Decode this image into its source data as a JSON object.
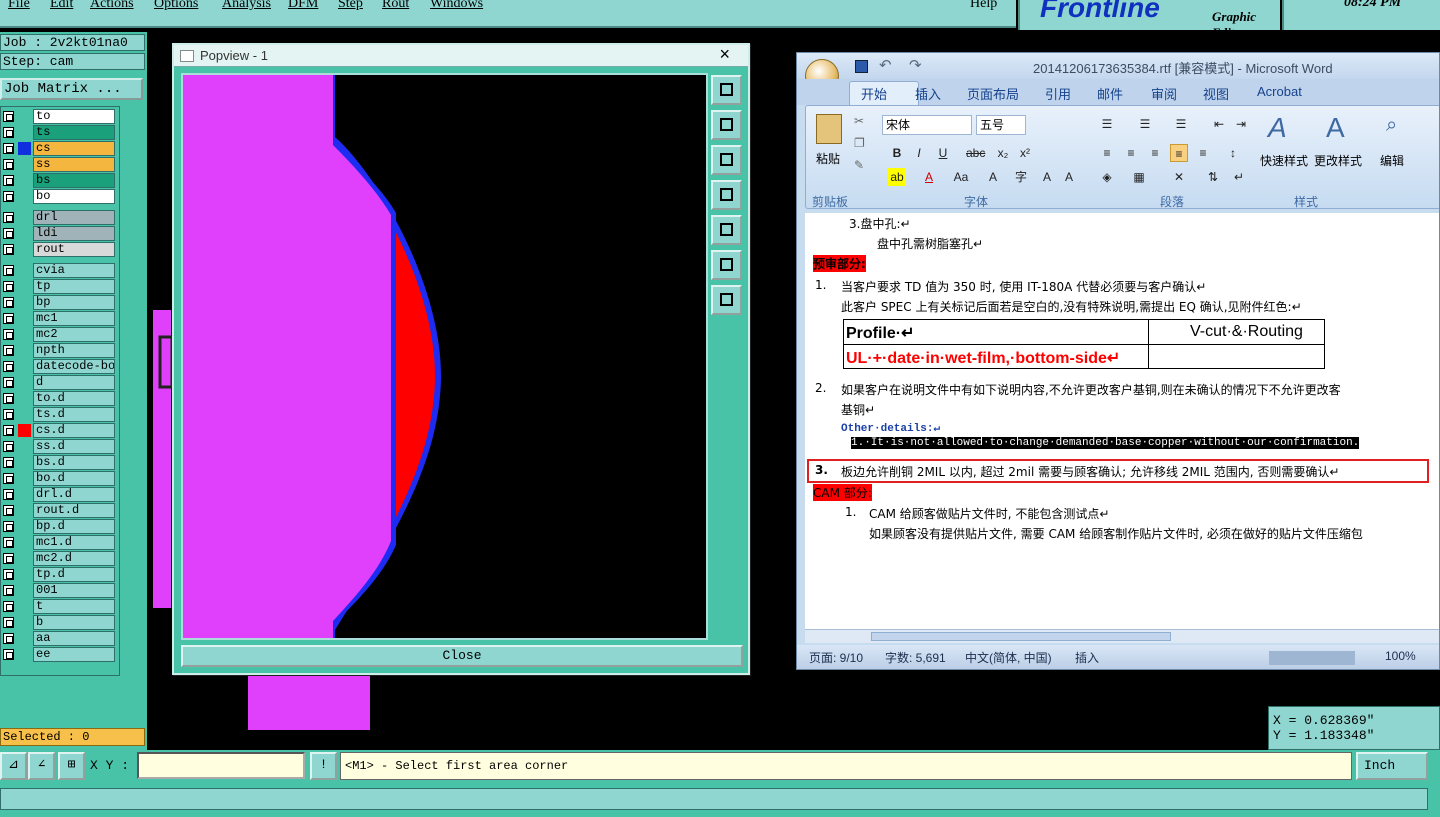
{
  "menu": {
    "items": [
      "File",
      "Edit",
      "Actions",
      "Options",
      "Analysis",
      "DFM",
      "Step",
      "Rout",
      "Windows"
    ],
    "help": "Help"
  },
  "brand": {
    "logo": "Frontline",
    "subtitle": "Graphic Editor"
  },
  "clock": "08:24 PM",
  "left_panel": {
    "job": "Job : 2v2kt01na0",
    "step": "Step: cam",
    "job_matrix": "Job Matrix ...",
    "selected": "Selected : 0",
    "layers": [
      {
        "name": "to",
        "color": "#ffffff",
        "swatch": ""
      },
      {
        "name": "ts",
        "color": "#1aa07a",
        "swatch": ""
      },
      {
        "name": "cs",
        "color": "#f4b63e",
        "swatch": "#1030e0"
      },
      {
        "name": "ss",
        "color": "#f4b63e",
        "swatch": ""
      },
      {
        "name": "bs",
        "color": "#1aa07a",
        "swatch": ""
      },
      {
        "name": "bo",
        "color": "#ffffff",
        "swatch": ""
      },
      {
        "name": "drl",
        "color": "#9fb3b8",
        "swatch": ""
      },
      {
        "name": "ldi",
        "color": "#9fb3b8",
        "swatch": ""
      },
      {
        "name": "rout",
        "color": "#d9d9d9",
        "swatch": ""
      },
      {
        "name": "cvia",
        "color": "#8fd6d0",
        "swatch": ""
      },
      {
        "name": "tp",
        "color": "#8fd6d0",
        "swatch": ""
      },
      {
        "name": "bp",
        "color": "#8fd6d0",
        "swatch": ""
      },
      {
        "name": "mc1",
        "color": "#8fd6d0",
        "swatch": ""
      },
      {
        "name": "mc2",
        "color": "#8fd6d0",
        "swatch": ""
      },
      {
        "name": "npth",
        "color": "#8fd6d0",
        "swatch": ""
      },
      {
        "name": "datecode-bo",
        "color": "#8fd6d0",
        "swatch": ""
      },
      {
        "name": "d",
        "color": "#8fd6d0",
        "swatch": ""
      },
      {
        "name": "to.d",
        "color": "#8fd6d0",
        "swatch": ""
      },
      {
        "name": "ts.d",
        "color": "#8fd6d0",
        "swatch": ""
      },
      {
        "name": "cs.d",
        "color": "#8fd6d0",
        "swatch": "#ff0000"
      },
      {
        "name": "ss.d",
        "color": "#8fd6d0",
        "swatch": ""
      },
      {
        "name": "bs.d",
        "color": "#8fd6d0",
        "swatch": ""
      },
      {
        "name": "bo.d",
        "color": "#8fd6d0",
        "swatch": ""
      },
      {
        "name": "drl.d",
        "color": "#8fd6d0",
        "swatch": ""
      },
      {
        "name": "rout.d",
        "color": "#8fd6d0",
        "swatch": ""
      },
      {
        "name": "bp.d",
        "color": "#8fd6d0",
        "swatch": ""
      },
      {
        "name": "mc1.d",
        "color": "#8fd6d0",
        "swatch": ""
      },
      {
        "name": "mc2.d",
        "color": "#8fd6d0",
        "swatch": ""
      },
      {
        "name": "tp.d",
        "color": "#8fd6d0",
        "swatch": ""
      },
      {
        "name": "001",
        "color": "#8fd6d0",
        "swatch": ""
      },
      {
        "name": "t",
        "color": "#8fd6d0",
        "swatch": ""
      },
      {
        "name": "b",
        "color": "#8fd6d0",
        "swatch": ""
      },
      {
        "name": "aa",
        "color": "#8fd6d0",
        "swatch": ""
      },
      {
        "name": "ee",
        "color": "#8fd6d0",
        "swatch": ""
      }
    ]
  },
  "popview": {
    "title": "Popview - 1",
    "close_x": "×",
    "close_button": "Close"
  },
  "word": {
    "title": "20141206173635384.rtf [兼容模式] - Microsoft Word",
    "tabs": [
      "开始",
      "插入",
      "页面布局",
      "引用",
      "邮件",
      "审阅",
      "视图",
      "Acrobat"
    ],
    "ribbon": {
      "paste": "粘贴",
      "font_name": "宋体",
      "font_size": "五号",
      "quick_styles": "快速样式",
      "change_styles": "更改样式",
      "edit": "编辑",
      "group_clipboard": "剪贴板",
      "group_font": "字体",
      "group_paragraph": "段落",
      "group_styles": "样式"
    },
    "doc": {
      "line_top": "3.盘中孔:↵",
      "line_resin": "盘中孔需树脂塞孔↵",
      "heading_pre": "预审部分:",
      "item1_num": "1.",
      "item1_text": "当客户要求 TD 值为 350 时, 使用 IT-180A 代替必须要与客户确认↵",
      "item1_sub": "此客户 SPEC 上有关标记后面若是空白的,没有特殊说明,需提出 EQ 确认,见附件红色:↵",
      "table_r1c1": "Profile·↵",
      "table_r1c2": "V-cut·&·Routing",
      "table_r2c1": "UL·+·date·in·wet-film,·bottom-side↵",
      "item2_num": "2.",
      "item2_text": "如果客户在说明文件中有如下说明内容,不允许更改客户基铜,则在未确认的情况下不允许更改客",
      "item2_sub": "基铜↵",
      "other_details": "Other·details:↵",
      "other_line": "1.·It·is·not·allowed·to·change·demanded·base·copper·without·our·confirmation.",
      "item3_num": "3.",
      "item3_text": "板边允许削铜 2MIL 以内, 超过 2mil 需要与顾客确认; 允许移线 2MIL 范围内, 否则需要确认↵",
      "heading_cam": "CAM 部分:",
      "cam1_num": "1.",
      "cam1_text": "CAM 给顾客做贴片文件时, 不能包含测试点↵",
      "cam1_sub": "如果顾客没有提供贴片文件, 需要 CAM 给顾客制作贴片文件时, 必须在做好的贴片文件压缩包"
    },
    "status": {
      "page": "页面: 9/10",
      "words": "字数: 5,691",
      "lang": "中文(简体, 中国)",
      "mode": "插入",
      "zoom": "100%"
    }
  },
  "coords": {
    "x": "X = 0.628369\"",
    "y": "Y = 1.183348\""
  },
  "bottom": {
    "xy_label": "X Y :",
    "xy_value": "",
    "prompt": "<M1> - Select first area corner",
    "unit": "Inch"
  }
}
